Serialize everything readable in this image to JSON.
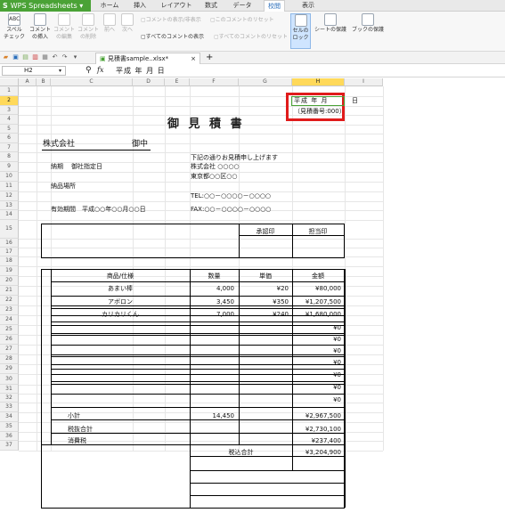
{
  "app": {
    "name": "WPS Spreadsheets"
  },
  "menu_tabs": [
    "ホーム",
    "挿入",
    "レイアウト",
    "数式",
    "データ",
    "校閲",
    "表示"
  ],
  "active_menu": "校閲",
  "ribbon": {
    "spell_label": "スペル\nチェック",
    "insert_comment": "コメント\nの挿入",
    "edit_comment": "コメント\nの編集",
    "delete_comment": "コメント\nの削除",
    "prev": "前へ",
    "next": "次へ",
    "show_hide_comment": "コメントの表示/非表示",
    "show_all_comments": "すべてのコメントの表示",
    "reset_comment": "このコメントのリセット",
    "reset_all_comments": "すべてのコメントのリセット",
    "lock_cell": "セルの\nロック",
    "protect_sheet": "シートの保護",
    "protect_book": "ブックの保護"
  },
  "document_tab": "見積書sample..xlsx*",
  "new_tab": "+",
  "name_box": "H2",
  "fx_label": "fx",
  "formula": "平成  年  月  日",
  "columns": [
    "A",
    "B",
    "C",
    "D",
    "E",
    "F",
    "G",
    "H",
    "I"
  ],
  "selected_column": "H",
  "rows": [
    "1",
    "2",
    "3",
    "4",
    "5",
    "6",
    "7",
    "8",
    "9",
    "10",
    "11",
    "12",
    "13",
    "14",
    "15",
    "16",
    "17",
    "18",
    "19",
    "20",
    "21",
    "22",
    "23",
    "24",
    "25",
    "26",
    "27",
    "28",
    "29",
    "30",
    "31",
    "32",
    "33",
    "34",
    "35",
    "36",
    "37"
  ],
  "selected_row": "2",
  "sheet": {
    "date_cell": "平成 年 月",
    "date_suffix": "日",
    "estimate_no": "（見積番号:000）",
    "title": "御 見 積 書",
    "company_to": "株式会社",
    "onchu": "御中",
    "intro": "下記の通りお見積申し上げます",
    "delivery_label": "納期",
    "delivery_value": "御社指定日",
    "sender_company": "株式会社 ○○○○",
    "sender_address": "東京都○○区○○",
    "place_label": "納品場所",
    "tel": "TEL:○○－○○○○－○○○○",
    "validity": "有効期間　平成○○年○○月○○日",
    "fax": "FAX:○○－○○○○－○○○○",
    "approval": "承認印",
    "person": "担当印",
    "table_headers": [
      "商品/仕様",
      "数量",
      "単価",
      "金額"
    ],
    "items": [
      {
        "name": "あまい棒",
        "qty": "4,000",
        "price": "¥20",
        "amount": "¥80,000"
      },
      {
        "name": "アボロン",
        "qty": "3,450",
        "price": "¥350",
        "amount": "¥1,207,500"
      },
      {
        "name": "カリカリくん",
        "qty": "7,000",
        "price": "¥240",
        "amount": "¥1,680,000"
      },
      {
        "name": "",
        "qty": "",
        "price": "",
        "amount": "¥0"
      },
      {
        "name": "",
        "qty": "",
        "price": "",
        "amount": "¥0"
      },
      {
        "name": "",
        "qty": "",
        "price": "",
        "amount": "¥0"
      },
      {
        "name": "",
        "qty": "",
        "price": "",
        "amount": "¥0"
      },
      {
        "name": "",
        "qty": "",
        "price": "",
        "amount": "¥0"
      },
      {
        "name": "",
        "qty": "",
        "price": "",
        "amount": "¥0"
      },
      {
        "name": "",
        "qty": "",
        "price": "",
        "amount": "¥0"
      }
    ],
    "subtotal_label": "小計",
    "subtotal_qty": "14,450",
    "subtotal_amount": "¥2,967,500",
    "pretax_label": "税抜合計",
    "pretax_amount": "¥2,730,100",
    "tax_label": "消費税",
    "tax_amount": "¥237,400",
    "total_label": "税込合計",
    "total_amount": "¥3,204,900"
  },
  "colors": {
    "accent_green": "#4aa236",
    "highlight_red": "#e01b1b",
    "header_selected": "#ffd95a"
  }
}
